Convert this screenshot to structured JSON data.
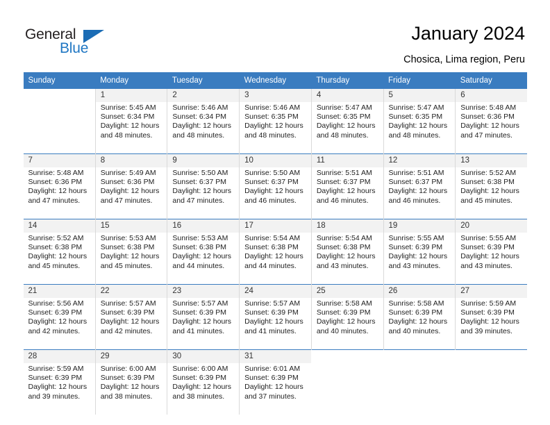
{
  "brand": {
    "name_part1": "General",
    "name_part2": "Blue",
    "triangle_color": "#1b6cb5",
    "blue_color": "#2077c3"
  },
  "header": {
    "title": "January 2024",
    "subtitle": "Chosica, Lima region, Peru"
  },
  "colors": {
    "header_row_bg": "#3a7cc0",
    "day_number_bg": "#f2f2f2",
    "week_separator": "#3a7cc0",
    "column_divider": "#d9d9d9"
  },
  "calendar": {
    "weekday_headers": [
      "Sunday",
      "Monday",
      "Tuesday",
      "Wednesday",
      "Thursday",
      "Friday",
      "Saturday"
    ],
    "weeks": [
      [
        {
          "day": "",
          "empty": true
        },
        {
          "day": "1",
          "sunrise": "Sunrise: 5:45 AM",
          "sunset": "Sunset: 6:34 PM",
          "daylight": "Daylight: 12 hours and 48 minutes."
        },
        {
          "day": "2",
          "sunrise": "Sunrise: 5:46 AM",
          "sunset": "Sunset: 6:34 PM",
          "daylight": "Daylight: 12 hours and 48 minutes."
        },
        {
          "day": "3",
          "sunrise": "Sunrise: 5:46 AM",
          "sunset": "Sunset: 6:35 PM",
          "daylight": "Daylight: 12 hours and 48 minutes."
        },
        {
          "day": "4",
          "sunrise": "Sunrise: 5:47 AM",
          "sunset": "Sunset: 6:35 PM",
          "daylight": "Daylight: 12 hours and 48 minutes."
        },
        {
          "day": "5",
          "sunrise": "Sunrise: 5:47 AM",
          "sunset": "Sunset: 6:35 PM",
          "daylight": "Daylight: 12 hours and 48 minutes."
        },
        {
          "day": "6",
          "sunrise": "Sunrise: 5:48 AM",
          "sunset": "Sunset: 6:36 PM",
          "daylight": "Daylight: 12 hours and 47 minutes."
        }
      ],
      [
        {
          "day": "7",
          "sunrise": "Sunrise: 5:48 AM",
          "sunset": "Sunset: 6:36 PM",
          "daylight": "Daylight: 12 hours and 47 minutes."
        },
        {
          "day": "8",
          "sunrise": "Sunrise: 5:49 AM",
          "sunset": "Sunset: 6:36 PM",
          "daylight": "Daylight: 12 hours and 47 minutes."
        },
        {
          "day": "9",
          "sunrise": "Sunrise: 5:50 AM",
          "sunset": "Sunset: 6:37 PM",
          "daylight": "Daylight: 12 hours and 47 minutes."
        },
        {
          "day": "10",
          "sunrise": "Sunrise: 5:50 AM",
          "sunset": "Sunset: 6:37 PM",
          "daylight": "Daylight: 12 hours and 46 minutes."
        },
        {
          "day": "11",
          "sunrise": "Sunrise: 5:51 AM",
          "sunset": "Sunset: 6:37 PM",
          "daylight": "Daylight: 12 hours and 46 minutes."
        },
        {
          "day": "12",
          "sunrise": "Sunrise: 5:51 AM",
          "sunset": "Sunset: 6:37 PM",
          "daylight": "Daylight: 12 hours and 46 minutes."
        },
        {
          "day": "13",
          "sunrise": "Sunrise: 5:52 AM",
          "sunset": "Sunset: 6:38 PM",
          "daylight": "Daylight: 12 hours and 45 minutes."
        }
      ],
      [
        {
          "day": "14",
          "sunrise": "Sunrise: 5:52 AM",
          "sunset": "Sunset: 6:38 PM",
          "daylight": "Daylight: 12 hours and 45 minutes."
        },
        {
          "day": "15",
          "sunrise": "Sunrise: 5:53 AM",
          "sunset": "Sunset: 6:38 PM",
          "daylight": "Daylight: 12 hours and 45 minutes."
        },
        {
          "day": "16",
          "sunrise": "Sunrise: 5:53 AM",
          "sunset": "Sunset: 6:38 PM",
          "daylight": "Daylight: 12 hours and 44 minutes."
        },
        {
          "day": "17",
          "sunrise": "Sunrise: 5:54 AM",
          "sunset": "Sunset: 6:38 PM",
          "daylight": "Daylight: 12 hours and 44 minutes."
        },
        {
          "day": "18",
          "sunrise": "Sunrise: 5:54 AM",
          "sunset": "Sunset: 6:38 PM",
          "daylight": "Daylight: 12 hours and 43 minutes."
        },
        {
          "day": "19",
          "sunrise": "Sunrise: 5:55 AM",
          "sunset": "Sunset: 6:39 PM",
          "daylight": "Daylight: 12 hours and 43 minutes."
        },
        {
          "day": "20",
          "sunrise": "Sunrise: 5:55 AM",
          "sunset": "Sunset: 6:39 PM",
          "daylight": "Daylight: 12 hours and 43 minutes."
        }
      ],
      [
        {
          "day": "21",
          "sunrise": "Sunrise: 5:56 AM",
          "sunset": "Sunset: 6:39 PM",
          "daylight": "Daylight: 12 hours and 42 minutes."
        },
        {
          "day": "22",
          "sunrise": "Sunrise: 5:57 AM",
          "sunset": "Sunset: 6:39 PM",
          "daylight": "Daylight: 12 hours and 42 minutes."
        },
        {
          "day": "23",
          "sunrise": "Sunrise: 5:57 AM",
          "sunset": "Sunset: 6:39 PM",
          "daylight": "Daylight: 12 hours and 41 minutes."
        },
        {
          "day": "24",
          "sunrise": "Sunrise: 5:57 AM",
          "sunset": "Sunset: 6:39 PM",
          "daylight": "Daylight: 12 hours and 41 minutes."
        },
        {
          "day": "25",
          "sunrise": "Sunrise: 5:58 AM",
          "sunset": "Sunset: 6:39 PM",
          "daylight": "Daylight: 12 hours and 40 minutes."
        },
        {
          "day": "26",
          "sunrise": "Sunrise: 5:58 AM",
          "sunset": "Sunset: 6:39 PM",
          "daylight": "Daylight: 12 hours and 40 minutes."
        },
        {
          "day": "27",
          "sunrise": "Sunrise: 5:59 AM",
          "sunset": "Sunset: 6:39 PM",
          "daylight": "Daylight: 12 hours and 39 minutes."
        }
      ],
      [
        {
          "day": "28",
          "sunrise": "Sunrise: 5:59 AM",
          "sunset": "Sunset: 6:39 PM",
          "daylight": "Daylight: 12 hours and 39 minutes."
        },
        {
          "day": "29",
          "sunrise": "Sunrise: 6:00 AM",
          "sunset": "Sunset: 6:39 PM",
          "daylight": "Daylight: 12 hours and 38 minutes."
        },
        {
          "day": "30",
          "sunrise": "Sunrise: 6:00 AM",
          "sunset": "Sunset: 6:39 PM",
          "daylight": "Daylight: 12 hours and 38 minutes."
        },
        {
          "day": "31",
          "sunrise": "Sunrise: 6:01 AM",
          "sunset": "Sunset: 6:39 PM",
          "daylight": "Daylight: 12 hours and 37 minutes."
        },
        {
          "day": "",
          "empty": true
        },
        {
          "day": "",
          "empty": true
        },
        {
          "day": "",
          "empty": true
        }
      ]
    ]
  }
}
